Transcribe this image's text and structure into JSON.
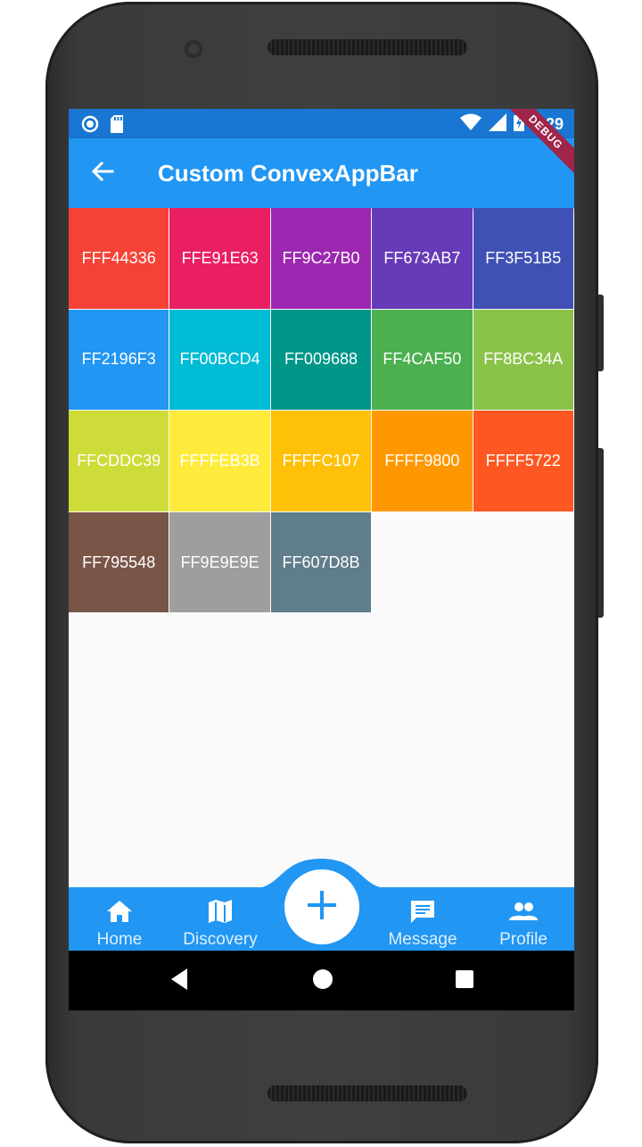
{
  "status_bar": {
    "time": "9:29",
    "left_icons": [
      "radio-button-icon",
      "sd-card-icon"
    ],
    "right_icons": [
      "wifi-icon",
      "signal-icon",
      "battery-charging-icon"
    ]
  },
  "app_bar": {
    "title": "Custom ConvexAppBar",
    "back_icon": "arrow-back-icon",
    "debug_banner": "DEBUG"
  },
  "colors": {
    "primary": "#2196F3",
    "status_bar": "#1976D2",
    "background": "#FAFAFA"
  },
  "tiles": [
    {
      "label": "FFF44336",
      "color": "#F44336"
    },
    {
      "label": "FFE91E63",
      "color": "#E91E63"
    },
    {
      "label": "FF9C27B0",
      "color": "#9C27B0"
    },
    {
      "label": "FF673AB7",
      "color": "#673AB7"
    },
    {
      "label": "FF3F51B5",
      "color": "#3F51B5"
    },
    {
      "label": "FF2196F3",
      "color": "#2196F3"
    },
    {
      "label": "FF00BCD4",
      "color": "#00BCD4"
    },
    {
      "label": "FF009688",
      "color": "#009688"
    },
    {
      "label": "FF4CAF50",
      "color": "#4CAF50"
    },
    {
      "label": "FF8BC34A",
      "color": "#8BC34A"
    },
    {
      "label": "FFCDDC39",
      "color": "#CDDC39"
    },
    {
      "label": "FFFFEB3B",
      "color": "#FFEB3B"
    },
    {
      "label": "FFFFC107",
      "color": "#FFC107"
    },
    {
      "label": "FFFF9800",
      "color": "#FF9800"
    },
    {
      "label": "FFFF5722",
      "color": "#FF5722"
    },
    {
      "label": "FF795548",
      "color": "#795548"
    },
    {
      "label": "FF9E9E9E",
      "color": "#9E9E9E"
    },
    {
      "label": "FF607D8B",
      "color": "#607D8B"
    }
  ],
  "bottom_bar": {
    "tabs": [
      {
        "label": "Home",
        "icon": "home-icon"
      },
      {
        "label": "Discovery",
        "icon": "map-icon"
      },
      {
        "label": "",
        "icon": "add-icon"
      },
      {
        "label": "Message",
        "icon": "message-icon"
      },
      {
        "label": "Profile",
        "icon": "people-icon"
      }
    ]
  },
  "system_nav": {
    "buttons": [
      "back-triangle-icon",
      "home-circle-icon",
      "recents-square-icon"
    ]
  }
}
